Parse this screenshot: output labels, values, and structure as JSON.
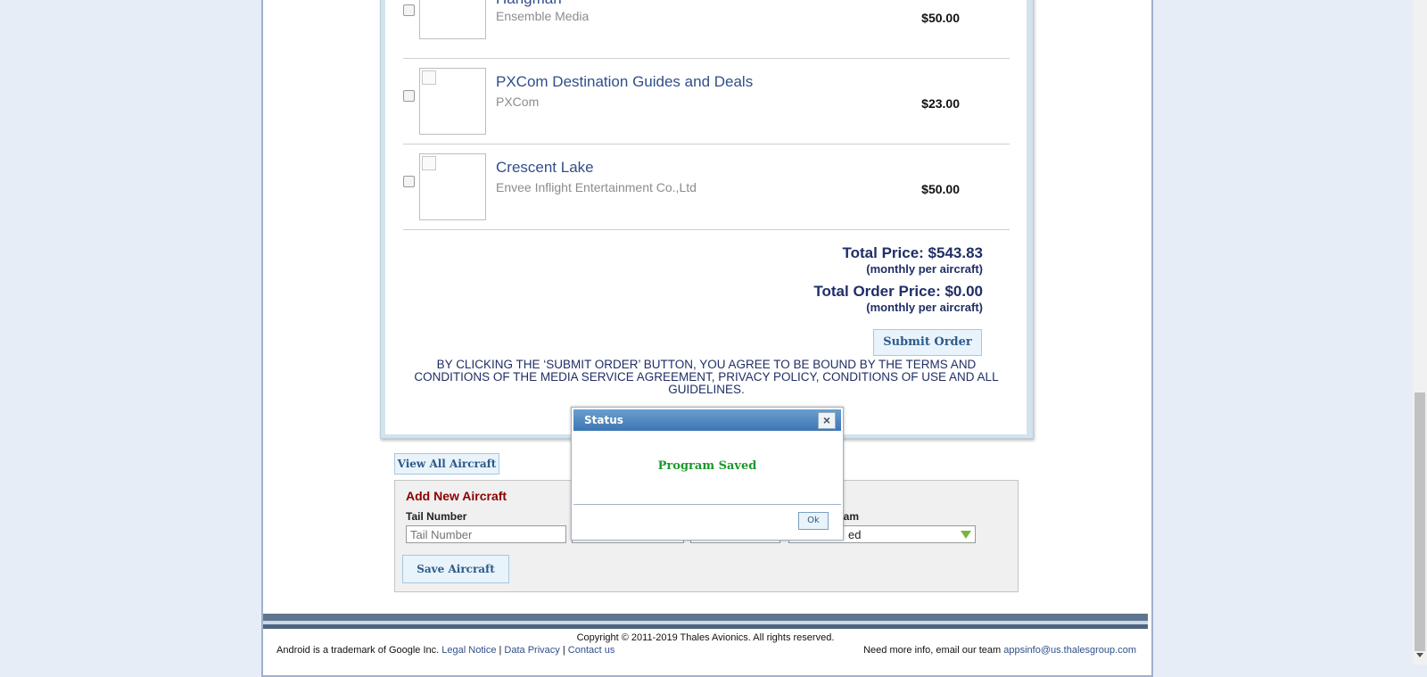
{
  "products": [
    {
      "title": "Hangman",
      "vendor": "Ensemble Media",
      "price": "$50.00"
    },
    {
      "title": "PXCom Destination Guides and Deals",
      "vendor": "PXCom",
      "price": "$23.00"
    },
    {
      "title": "Crescent Lake",
      "vendor": "Envee Inflight Entertainment Co.,Ltd",
      "price": "$50.00"
    }
  ],
  "totals": {
    "total_price": "Total Price: $543.83",
    "total_price_note": "(monthly per aircraft)",
    "total_order_price": "Total Order Price: $0.00",
    "total_order_note": "(monthly per aircraft)"
  },
  "submit_label": "Submit Order",
  "terms_text": "BY CLICKING THE ‘SUBMIT ORDER’ BUTTON, YOU AGREE TO BE BOUND BY THE TERMS AND CONDITIONS OF THE MEDIA SERVICE AGREEMENT, PRIVACY POLICY, CONDITIONS OF USE AND ALL GUIDELINES.",
  "view_all_label": "View All Aircraft",
  "add_aircraft": {
    "heading": "Add New Aircraft",
    "tail_label": "Tail Number",
    "tail_placeholder": "Tail Number",
    "program_label_partial": "ram",
    "program_value_partial": "ed",
    "save_label": "Save Aircraft"
  },
  "modal": {
    "title": "Status",
    "close_glyph": "×",
    "message": "Program Saved",
    "ok_label": "Ok"
  },
  "footer": {
    "copyright": "Copyright © 2011-2019 Thales Avionics. All rights reserved.",
    "trademark": "Android is a trademark of Google Inc.",
    "links": [
      "Legal Notice",
      "Data Privacy",
      "Contact us"
    ],
    "separator": "|",
    "info_text": "Need more info, email our team",
    "email": "appsinfo@us.thalesgroup.com"
  }
}
